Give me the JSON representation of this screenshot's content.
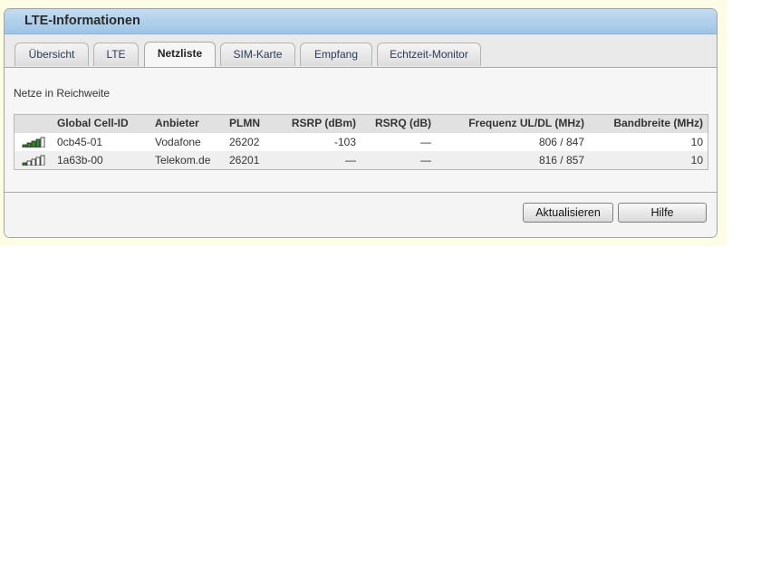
{
  "panel": {
    "title": "LTE-Informationen"
  },
  "tabs": [
    {
      "label": "Übersicht",
      "active": false
    },
    {
      "label": "LTE",
      "active": false
    },
    {
      "label": "Netzliste",
      "active": true
    },
    {
      "label": "SIM-Karte",
      "active": false
    },
    {
      "label": "Empfang",
      "active": false
    },
    {
      "label": "Echtzeit-Monitor",
      "active": false
    }
  ],
  "section": {
    "title": "Netze in Reichweite"
  },
  "table": {
    "columns": [
      "Global Cell-ID",
      "Anbieter",
      "PLMN",
      "RSRP (dBm)",
      "RSRQ (dB)",
      "Frequenz UL/DL (MHz)",
      "Bandbreite (MHz)"
    ],
    "rows": [
      {
        "signal_bars": 4,
        "cell_id": "0cb45-01",
        "provider": "Vodafone",
        "plmn": "26202",
        "rsrp": "-103",
        "rsrq": "—",
        "freq": "806 / 847",
        "bandwidth": "10"
      },
      {
        "signal_bars": 1,
        "cell_id": "1a63b-00",
        "provider": "Telekom.de",
        "plmn": "26201",
        "rsrp": "—",
        "rsrq": "—",
        "freq": "816 / 857",
        "bandwidth": "10"
      }
    ]
  },
  "buttons": {
    "refresh": "Aktualisieren",
    "help": "Hilfe"
  },
  "colors": {
    "header": "#9ec5e6",
    "signal_active": "#2e8b2e",
    "signal_inactive": "#cccccc"
  }
}
